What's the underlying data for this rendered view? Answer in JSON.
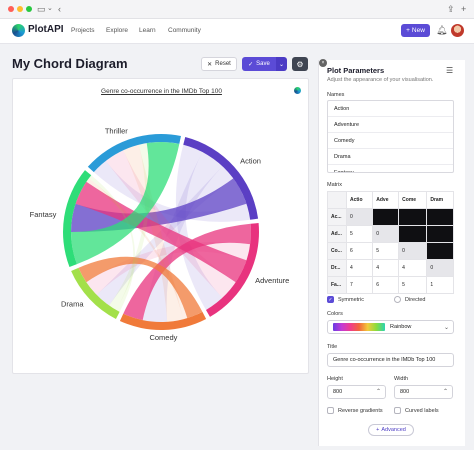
{
  "app": {
    "name": "PlotAPI"
  },
  "nav": {
    "links": [
      "Projects",
      "Explore",
      "Learn",
      "Community"
    ],
    "new_label": "New"
  },
  "page": {
    "title": "My Chord Diagram",
    "reset_label": "Reset",
    "save_label": "Save"
  },
  "chart_data": {
    "type": "chord",
    "title": "Genre co-occurrence in the IMDb Top 100",
    "names": [
      "Action",
      "Adventure",
      "Comedy",
      "Drama",
      "Fantasy",
      "Thriller"
    ],
    "colors": [
      "#5b3fc4",
      "#e8337e",
      "#f07a3a",
      "#a3e04a",
      "#2edd78",
      "#2a9bd8"
    ],
    "matrix": [
      [
        0,
        5,
        6,
        4,
        7,
        4
      ],
      [
        5,
        0,
        5,
        4,
        6,
        5
      ],
      [
        6,
        5,
        0,
        4,
        1,
        4
      ],
      [
        4,
        4,
        4,
        0,
        1,
        2
      ],
      [
        7,
        6,
        1,
        1,
        0,
        8
      ],
      [
        4,
        5,
        4,
        2,
        8,
        0
      ]
    ]
  },
  "panel": {
    "title": "Plot Parameters",
    "subtitle": "Adjust the appearance of your visualisation.",
    "names_label": "Names",
    "names": [
      "Action",
      "Adventure",
      "Comedy",
      "Drama",
      "Fantasy"
    ],
    "matrix_label": "Matrix",
    "matrix_headers": [
      "Actio",
      "Adve",
      "Come",
      "Dram"
    ],
    "matrix_rows": [
      {
        "label": "Ac...",
        "cells": [
          "0",
          "",
          "",
          ""
        ]
      },
      {
        "label": "Ad...",
        "cells": [
          "5",
          "0",
          "",
          ""
        ]
      },
      {
        "label": "Co...",
        "cells": [
          "6",
          "5",
          "0",
          ""
        ]
      },
      {
        "label": "Dr...",
        "cells": [
          "4",
          "4",
          "4",
          "0"
        ]
      },
      {
        "label": "Fa...",
        "cells": [
          "7",
          "6",
          "5",
          "1"
        ]
      }
    ],
    "symmetric_label": "Symmetric",
    "directed_label": "Directed",
    "colors_label": "Colors",
    "colors_value": "Rainbow",
    "title_label": "Title",
    "title_value": "Genre co-occurrence in the IMDb Top 100",
    "height_label": "Height",
    "height_value": "800",
    "width_label": "Width",
    "width_value": "800",
    "reverse_label": "Reverse gradients",
    "curved_label": "Curved labels",
    "advanced_label": "Advanced"
  }
}
